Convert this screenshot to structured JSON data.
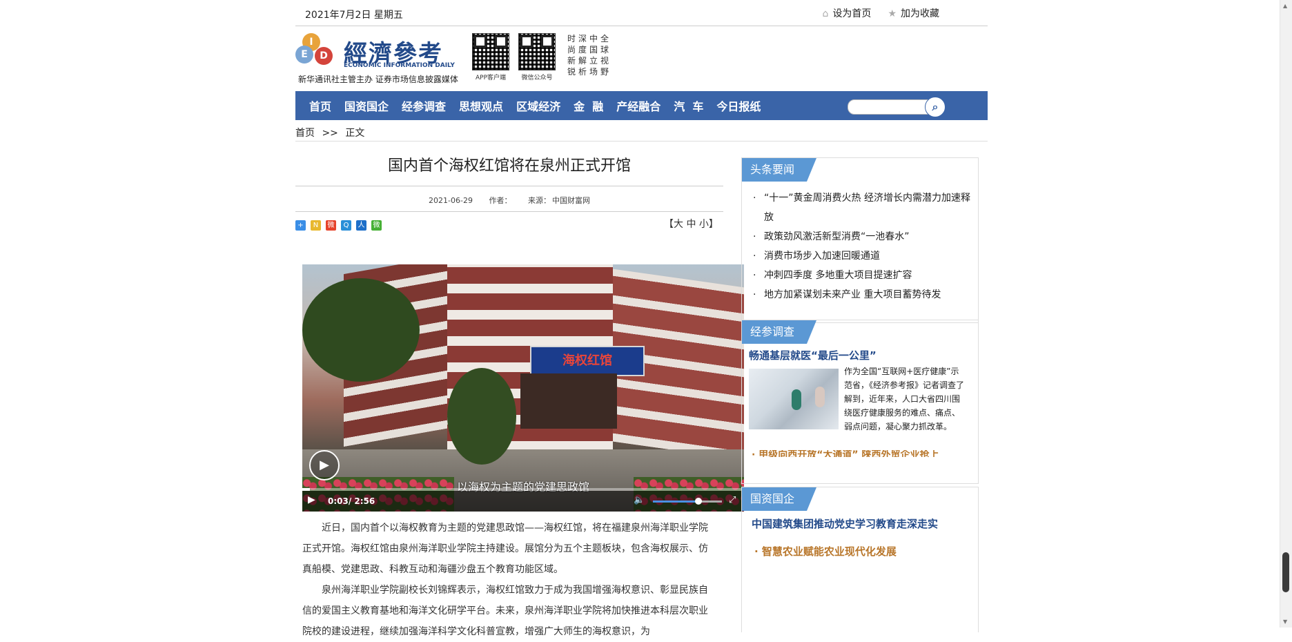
{
  "topbar": {
    "date": "2021年7月2日  星期五",
    "set_home": "设为首页",
    "bookmark": "加为收藏"
  },
  "header": {
    "logo_name": "經濟參考",
    "logo_en": "ECONOMIC INFORMATION DAILY",
    "logo_letters": [
      "I",
      "E",
      "D"
    ],
    "logo_sub": "新华通讯社主管主办 证券市场信息披露媒体",
    "qr_app": "APP客户端",
    "qr_wechat": "微信公众号",
    "slogan": [
      "时深中全",
      "尚度国球",
      "新解立视",
      "锐析场野"
    ]
  },
  "nav": [
    "首页",
    "国资国企",
    "经参调查",
    "思想观点",
    "区域经济",
    "金  融",
    "产经融合",
    "汽  车",
    "今日报纸"
  ],
  "breadcrumb": {
    "home": "首页",
    "sep": ">>",
    "current": "正文"
  },
  "article": {
    "title": "国内首个海权红馆将在泉州正式开馆",
    "date": "2021-06-29",
    "author_label": "作者：",
    "source_label": "来源：",
    "source": "中国财富网",
    "font_sizes": "【大 中 小】",
    "video": {
      "sign_text": "海权红馆",
      "caption": "以海权为主题的党建思政馆",
      "time": "0:03/ 2:56",
      "progress": 0.017,
      "volume": 0.66
    },
    "paragraphs": [
      "近日，国内首个以海权教育为主题的党建思政馆——海权红馆，将在福建泉州海洋职业学院正式开馆。海权红馆由泉州海洋职业学院主持建设。展馆分为五个主题板块，包含海权展示、仿真船模、党建思政、科教互动和海疆沙盘五个教育功能区域。",
      "泉州海洋职业学院副校长刘锦辉表示，海权红馆致力于成为我国增强海权意识、彰显民族自信的爱国主义教育基地和海洋文化研学平台。未来，泉州海洋职业学院将加快推进本科层次职业院校的建设进程，继续加强海洋科学文化科普宣教，增强广大师生的海权意识，为"
    ]
  },
  "share_icons": [
    "plus-icon",
    "n-icon",
    "weibo-icon",
    "qzone-icon",
    "renren-icon",
    "wechat-icon"
  ],
  "colors": {
    "nav_bg": "#3a64a8",
    "tab_bg": "#5b98d4",
    "headline": "#234a8a",
    "gold": "#b8762a"
  },
  "sidebar": {
    "headlines": {
      "tab": "头条要闻",
      "items": [
        "“十一”黄金周消费火热 经济增长内需潜力加速释放",
        "政策劲风激活新型消费“一池春水”",
        "消费市场步入加速回暖通道",
        "冲刺四季度   多地重大项目提速扩容",
        "地方加紧谋划未来产业   重大项目蓄势待发"
      ]
    },
    "survey": {
      "tab": "经参调查",
      "title": "畅通基层就医“最后一公里”",
      "text": "作为全国“互联网+医疗健康”示范省，《经济参考报》记者调查了解到，近年来，人口大省四川围绕医疗健康服务的难点、痛点、弱点问题，凝心聚力抓改革。",
      "more": "· 甲级向西开放“大通道” 陕西外贸企业抢上"
    },
    "soe": {
      "tab": "国资国企",
      "item1": "中国建筑集团推动党史学习教育走深走实",
      "item2": "· 智慧农业赋能农业现代化发展"
    }
  }
}
